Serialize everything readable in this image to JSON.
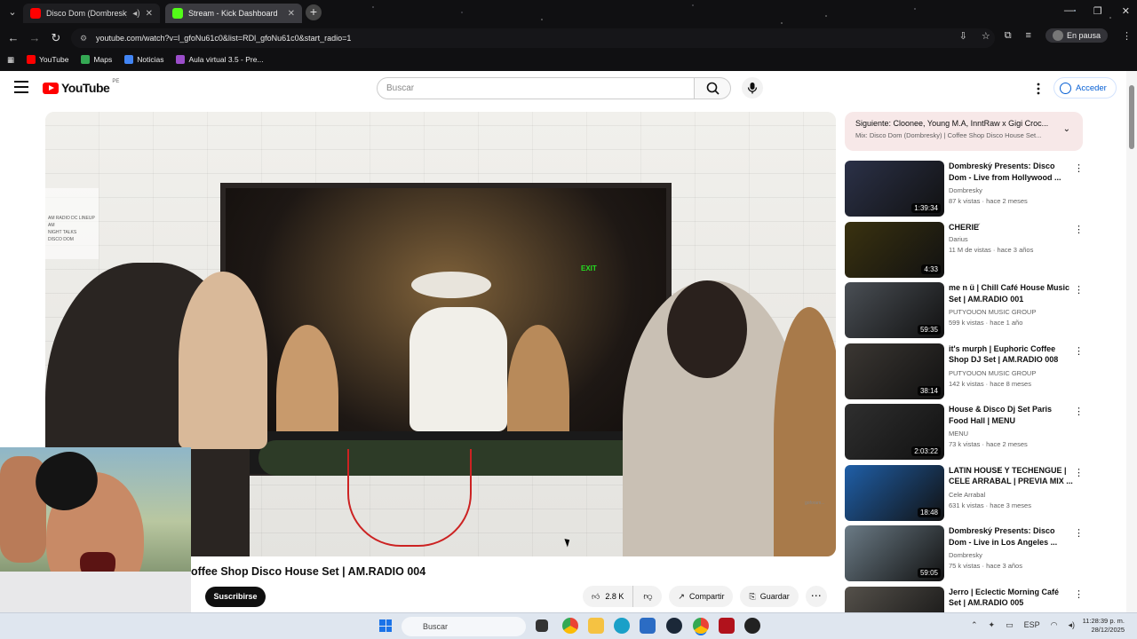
{
  "browser": {
    "tabs": [
      {
        "label": "Disco Dom (Dombresky) | C",
        "active": false
      },
      {
        "label": "Stream - Kick Dashboard",
        "active": true
      }
    ],
    "url": "youtube.com/watch?v=l_gfoNu61c0&list=RDl_gfoNu61c0&start_radio=1",
    "profile_status": "En pausa",
    "bookmarks": [
      "YouTube",
      "Maps",
      "Noticias",
      "Aula virtual 3.5 - Pre..."
    ]
  },
  "youtube": {
    "logo_text": "YouTube",
    "logo_region": "PE",
    "search_placeholder": "Buscar",
    "signin_label": "Acceder",
    "video_title": "offee Shop Disco House Set | AM.RADIO 004",
    "subscribe_label": "Suscribirse",
    "like_count": "2.8 K",
    "share_label": "Compartir",
    "save_label": "Guardar",
    "overlay_text": {
      "exit_sign": "EXIT",
      "poster": "AM RADIO DC LINEUP\nAM\nNIGHT TALKS\nDISCO DOM",
      "watermark": "goforam..."
    },
    "next_up": {
      "line1": "Siguiente: Cloonee, Young M.A, InntRaw x Gigi Croc...",
      "line2": "Mix: Disco Dom (Dombresky) | Coffee Shop Disco House Set..."
    },
    "recommendations": [
      {
        "title": "Dombresky Presents: Disco Dom - Live from Hollywood ...",
        "channel": "Dombresky",
        "verified": true,
        "meta": "87 k vistas · hace 2 meses",
        "duration": "1:39:34",
        "thumb_color": "#2b3148"
      },
      {
        "title": "CHERIE",
        "channel": "Darius",
        "verified": true,
        "meta": "11 M de vistas · hace 3 años",
        "duration": "4:33",
        "thumb_color": "#3a3210"
      },
      {
        "title": "me n ü | Chill Café House Music Set | AM.RADIO 001",
        "channel": "PUTYOUON MUSIC GROUP",
        "verified": false,
        "meta": "599 k vistas · hace 1 año",
        "duration": "59:35",
        "thumb_color": "#4a4f55"
      },
      {
        "title": "it's murph | Euphoric Coffee Shop DJ Set | AM.RADIO 008",
        "channel": "PUTYOUON MUSIC GROUP",
        "verified": false,
        "meta": "142 k vistas · hace 8 meses",
        "duration": "38:14",
        "thumb_color": "#3b3733"
      },
      {
        "title": "House & Disco Dj Set Paris Food Hall | MENU",
        "channel": "MENU",
        "verified": false,
        "meta": "73 k vistas · hace 2 meses",
        "duration": "2:03:22",
        "thumb_color": "#2f2f2f"
      },
      {
        "title": "LATIN HOUSE Y TECHENGUE | CELE ARRABAL | PREVIA MIX ...",
        "channel": "Cele Arrabal",
        "verified": true,
        "meta": "631 k vistas · hace 3 meses",
        "duration": "18:48",
        "thumb_color": "#1f5fa8"
      },
      {
        "title": "Dombresky Presents: Disco Dom - Live in Los Angeles ...",
        "channel": "Dombresky",
        "verified": true,
        "meta": "75 k vistas · hace 3 años",
        "duration": "59:05",
        "thumb_color": "#6b7b86"
      },
      {
        "title": "Jerro | Eclectic Morning Café Set | AM.RADIO 005",
        "channel": "",
        "verified": false,
        "meta": "",
        "duration": "",
        "thumb_color": "#55514b"
      }
    ]
  },
  "taskbar": {
    "search_placeholder": "Buscar",
    "lang": "ESP",
    "time": "11:28:39 p. m.",
    "date": "28/12/2025"
  }
}
